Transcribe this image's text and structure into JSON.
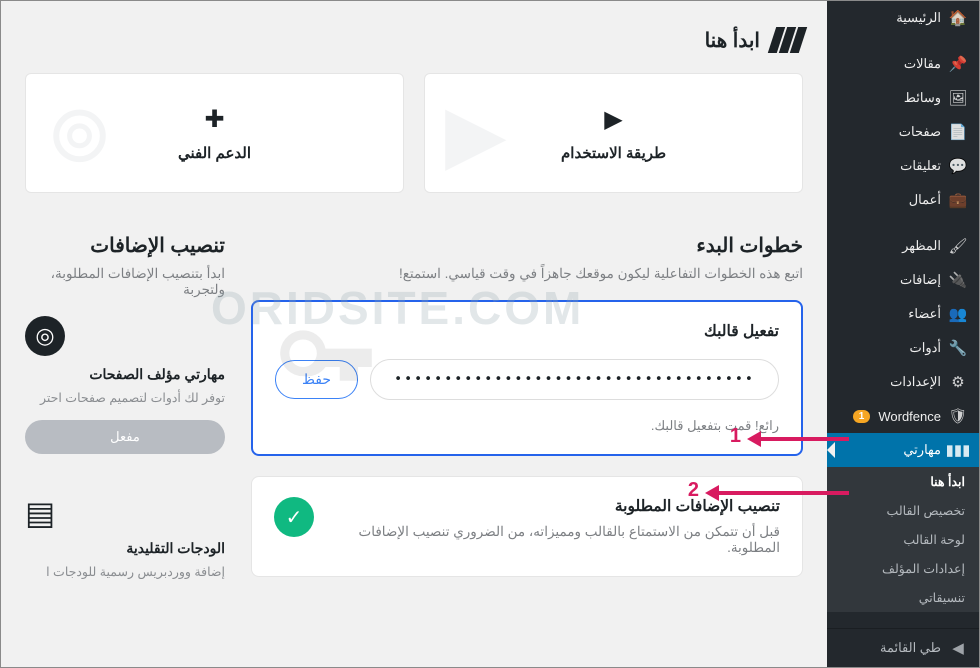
{
  "watermark": "ORIDSITE.COM",
  "sidebar": {
    "dashboard": "الرئيسية",
    "posts": "مقالات",
    "media": "وسائط",
    "pages": "صفحات",
    "comments": "تعليقات",
    "works": "أعمال",
    "appearance": "المظهر",
    "plugins": "إضافات",
    "users": "أعضاء",
    "tools": "أدوات",
    "settings": "الإعدادات",
    "wordfence": "Wordfence",
    "wordfence_badge": "1",
    "maharti": "مهارتي",
    "sub": {
      "start_here": "ابدأ هنا",
      "customize": "تخصيص القالب",
      "panel": "لوحة القالب",
      "author": "إعدادات المؤلف",
      "formats": "تنسيقاتي"
    },
    "collapse": "طي القائمة"
  },
  "welcome": {
    "title": "ابدأ هنا"
  },
  "cards": {
    "usage": "طريقة الاستخدام",
    "support": "الدعم الفني"
  },
  "start": {
    "title": "خطوات البدء",
    "subtitle": "اتبع هذه الخطوات التفاعلية ليكون موقعك جاهزاً في وقت قياسي. استمتع!"
  },
  "activate": {
    "title": "تفعيل قالبك",
    "value": "••••••••••••••••••••••••••••••••••••",
    "save": "حفظ",
    "done": "رائع! قمت بتفعيل قالبك."
  },
  "required_plugins": {
    "title": "تنصيب الإضافات المطلوبة",
    "desc": "قبل أن تتمكن من الاستمتاع بالقالب ومميزاته، من الضروري تنصيب الإضافات المطلوبة."
  },
  "plugins_panel": {
    "title": "تنصيب الإضافات",
    "desc": "ابدأ بتنصيب الإضافات المطلوبة، ولتجربة",
    "plugin_name": "مهارتي مؤلف الصفحات",
    "plugin_desc": "توفر لك أدوات لتصميم صفحات احتر",
    "active_btn": "مفعل"
  },
  "widgets_panel": {
    "title": "الودجات التقليدية",
    "desc": "إضافة ووردبريس رسمية للودجات ا"
  },
  "annotations": {
    "one": "1",
    "two": "2"
  }
}
